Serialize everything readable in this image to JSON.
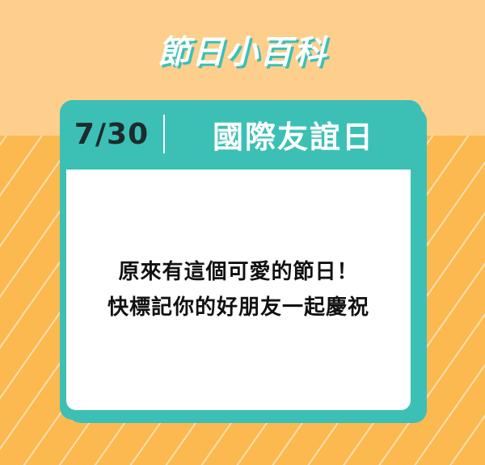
{
  "banner": {
    "title": "節日小百科"
  },
  "card": {
    "date": "7/30",
    "holiday": "國際友誼日",
    "lines": [
      "原來有這個可愛的節日！",
      "快標記你的好朋友一起慶祝"
    ]
  },
  "colors": {
    "top_background": "#FECF8C",
    "bottom_background": "#FBB950",
    "accent_teal": "#3CC0B6",
    "white": "#FFFFFF"
  }
}
